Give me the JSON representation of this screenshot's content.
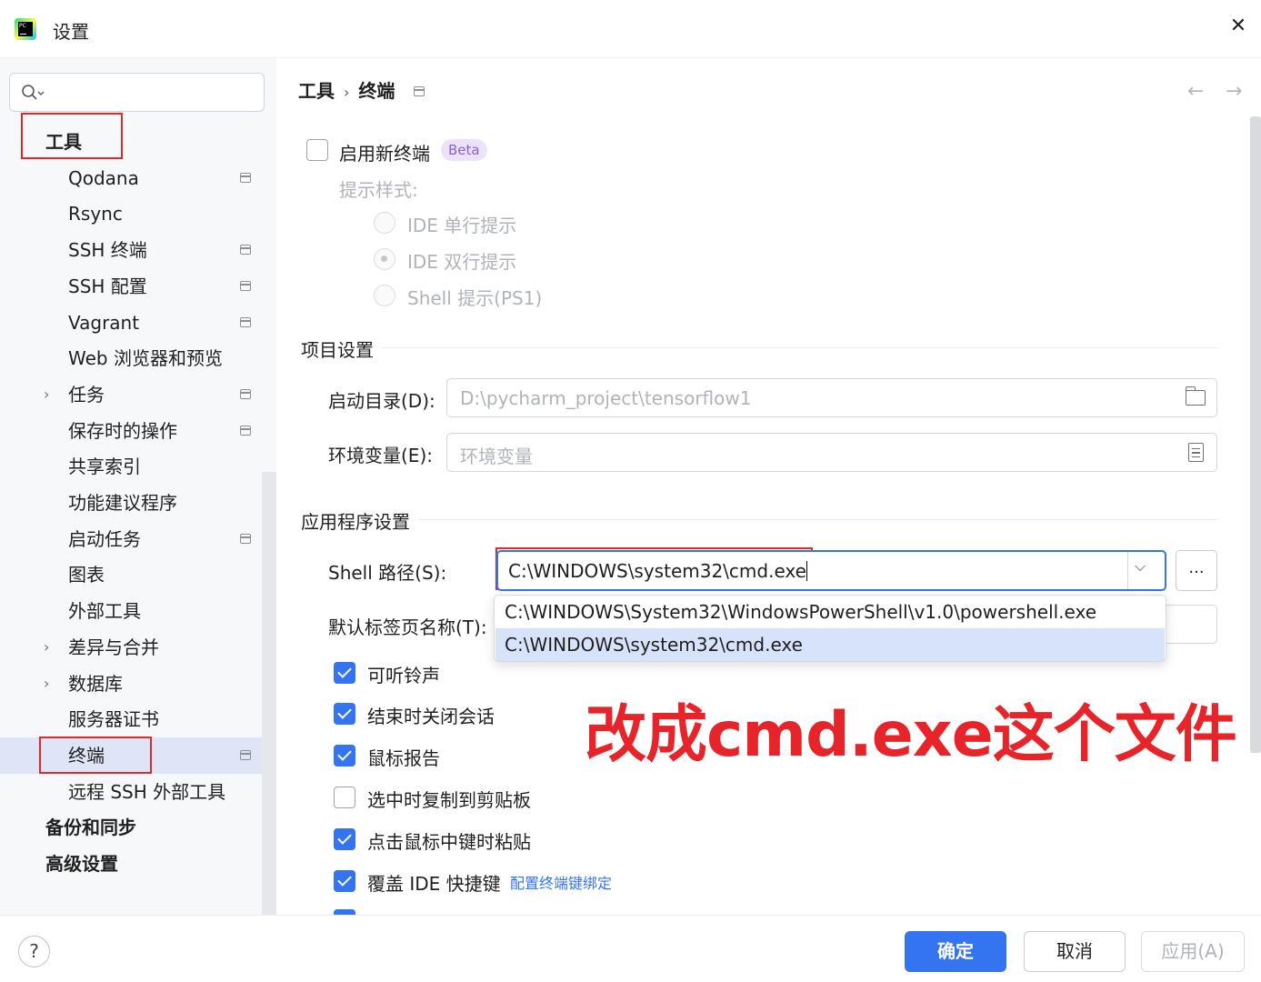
{
  "window": {
    "title": "设置",
    "close_glyph": "✕"
  },
  "sidebar": {
    "search_placeholder": "",
    "items": [
      {
        "label": "工具",
        "level": 0,
        "pin": false,
        "chevron": false
      },
      {
        "label": "Qodana",
        "level": 1,
        "pin": true,
        "chevron": false
      },
      {
        "label": "Rsync",
        "level": 1,
        "pin": false,
        "chevron": false
      },
      {
        "label": "SSH 终端",
        "level": 1,
        "pin": true,
        "chevron": false
      },
      {
        "label": "SSH 配置",
        "level": 1,
        "pin": true,
        "chevron": false
      },
      {
        "label": "Vagrant",
        "level": 1,
        "pin": true,
        "chevron": false
      },
      {
        "label": "Web 浏览器和预览",
        "level": 1,
        "pin": false,
        "chevron": false
      },
      {
        "label": "任务",
        "level": 1,
        "pin": true,
        "chevron": true
      },
      {
        "label": "保存时的操作",
        "level": 1,
        "pin": true,
        "chevron": false
      },
      {
        "label": "共享索引",
        "level": 1,
        "pin": false,
        "chevron": false
      },
      {
        "label": "功能建议程序",
        "level": 1,
        "pin": false,
        "chevron": false
      },
      {
        "label": "启动任务",
        "level": 1,
        "pin": true,
        "chevron": false
      },
      {
        "label": "图表",
        "level": 1,
        "pin": false,
        "chevron": false
      },
      {
        "label": "外部工具",
        "level": 1,
        "pin": false,
        "chevron": false
      },
      {
        "label": "差异与合并",
        "level": 1,
        "pin": false,
        "chevron": true
      },
      {
        "label": "数据库",
        "level": 1,
        "pin": false,
        "chevron": true
      },
      {
        "label": "服务器证书",
        "level": 1,
        "pin": false,
        "chevron": false
      },
      {
        "label": "终端",
        "level": 1,
        "pin": true,
        "chevron": false,
        "selected": true
      },
      {
        "label": "远程 SSH 外部工具",
        "level": 1,
        "pin": false,
        "chevron": false
      },
      {
        "label": "备份和同步",
        "level": 0,
        "pin": false,
        "chevron": false
      },
      {
        "label": "高级设置",
        "level": 0,
        "pin": false,
        "chevron": false
      }
    ]
  },
  "breadcrumb": {
    "parent": "工具",
    "separator": "›",
    "current": "终端",
    "back_glyph": "←",
    "forward_glyph": "→"
  },
  "terminal": {
    "new_terminal_label": "启用新终端",
    "new_terminal_checked": false,
    "beta_badge": "Beta",
    "prompt_style_label": "提示样式:",
    "prompt_options": [
      {
        "label": "IDE 单行提示",
        "selected": false
      },
      {
        "label": "IDE 双行提示",
        "selected": true
      },
      {
        "label": "Shell 提示(PS1)",
        "selected": false
      }
    ]
  },
  "project_settings": {
    "heading": "项目设置",
    "start_dir_label": "启动目录(D):",
    "start_dir_value": "D:\\pycharm_project\\tensorflow1",
    "env_label": "环境变量(E):",
    "env_placeholder": "环境变量"
  },
  "app_settings": {
    "heading": "应用程序设置",
    "shell_path_label": "Shell 路径(S):",
    "shell_path_value": "C:\\WINDOWS\\system32\\cmd.exe",
    "browse_label": "...",
    "dropdown_options": [
      {
        "label": "C:\\WINDOWS\\System32\\WindowsPowerShell\\v1.0\\powershell.exe",
        "selected": false
      },
      {
        "label": "C:\\WINDOWS\\system32\\cmd.exe",
        "selected": true
      }
    ],
    "tab_name_label": "默认标签页名称(T):",
    "options": [
      {
        "label": "可听铃声",
        "checked": true
      },
      {
        "label": "结束时关闭会话",
        "checked": true
      },
      {
        "label": "鼠标报告",
        "checked": true
      },
      {
        "label": "选中时复制到剪贴板",
        "checked": false
      },
      {
        "label": "点击鼠标中键时粘贴",
        "checked": true
      },
      {
        "label": "覆盖 IDE 快捷键",
        "checked": true
      }
    ],
    "keybinding_link": "配置终端键绑定"
  },
  "annotation": "改成cmd.exe这个文件",
  "footer": {
    "help_glyph": "?",
    "ok_label": "确定",
    "cancel_label": "取消",
    "apply_label": "应用(A)"
  },
  "colors": {
    "accent": "#3574f0",
    "annotation_red": "#e8242b",
    "selection_bg": "#dfe5f7"
  }
}
